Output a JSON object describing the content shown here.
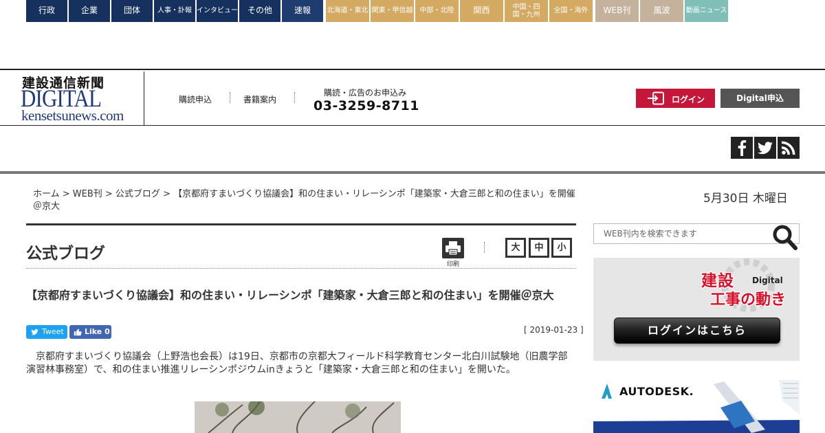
{
  "ad": {
    "info_icon": "info-icon"
  },
  "logo": {
    "kanji": "建設通信新聞",
    "digital": "DIGITAL",
    "domain": "kensetsunews.com"
  },
  "header": {
    "nav": [
      "購読申込",
      "書籍案内"
    ],
    "phone_label": "購読・広告のお申込み",
    "phone": "03-3259-8711",
    "login_label": "ログイン",
    "digital_label": "Digital申込"
  },
  "categories": [
    {
      "label": "行政"
    },
    {
      "label": "企業"
    },
    {
      "label": "団体"
    },
    {
      "label": "人事・訃報"
    },
    {
      "label": "インタビュー"
    },
    {
      "label": "その他"
    },
    {
      "label": "速報"
    },
    {
      "label": "北海道・東北"
    },
    {
      "label": "関東・甲信越"
    },
    {
      "label": "中部・北陸"
    },
    {
      "label": "関西"
    },
    {
      "label": "中国・四国・九州"
    },
    {
      "label": "全国・海外"
    },
    {
      "label": "WEB刊"
    },
    {
      "label": "風波"
    },
    {
      "label": "動画ニュース"
    }
  ],
  "social": {
    "facebook": "facebook-icon",
    "twitter": "twitter-icon",
    "rss": "rss-icon"
  },
  "breadcrumb": "ホーム > WEB刊 > 公式ブログ > 【京都府すまいづくり協議会】和の住まい・リレーシンポ「建築家・大倉三郎と和の住まい」を開催＠京大",
  "date": "5月30日  木曜日",
  "section": {
    "title": "公式ブログ",
    "print_label": "印刷",
    "font_sizes": [
      "大",
      "中",
      "小"
    ]
  },
  "article": {
    "title": "【京都府すまいづくり協議会】和の住まい・リレーシンポ「建築家・大倉三郎と和の住まい」を開催＠京大",
    "tweet_label": "Tweet",
    "like_label": "Like 0",
    "date": "[ 2019-01-23 ]",
    "body": "　京都府すまいづくり協議会（上野浩也会長）は19日、京都市の京都大フィールド科学教育センター北白川試験地（旧農学部演習林事務室）で、和の住まい推進リレーシンポジウムinきょうと「建築家・大倉三郎と和の住まい」を開いた。"
  },
  "search": {
    "placeholder": "WEB刊内を検索できます"
  },
  "banner1": {
    "title_line1": "建設",
    "title_digital": "Digital",
    "title_line2": "工事の動き",
    "button": "ログインはこちら"
  },
  "banner2": {
    "brand": "AUTODESK."
  },
  "colors": {
    "navy": "#16315e",
    "tan": "#d4a961",
    "beige": "#c4b29d",
    "teal": "#7fbfb8",
    "login_red": "#c4173a",
    "logo_blue": "#1f3a78"
  }
}
